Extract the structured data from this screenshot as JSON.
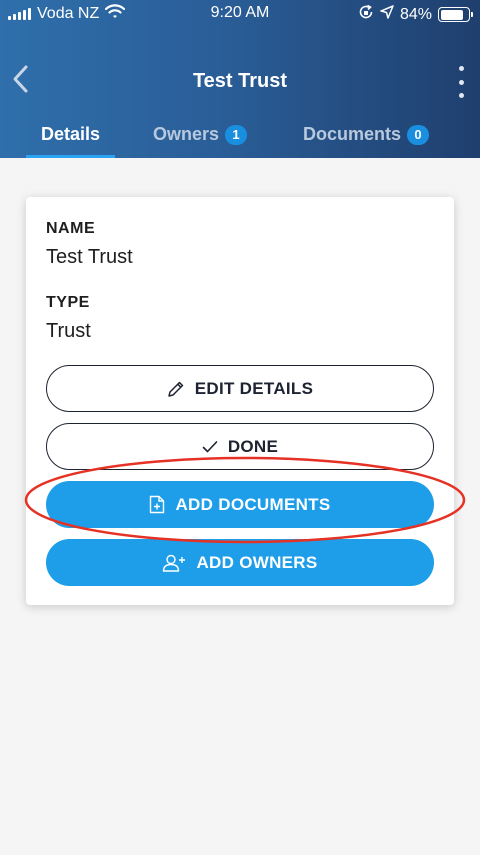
{
  "status_bar": {
    "carrier": "Voda NZ",
    "time": "9:20 AM",
    "battery_percent": "84%",
    "battery_level": 0.84
  },
  "nav": {
    "title": "Test Trust",
    "back_icon": "chevron-left-icon",
    "more_icon": "more-vertical-icon"
  },
  "tabs": [
    {
      "label": "Details",
      "active": true
    },
    {
      "label": "Owners",
      "count": "1"
    },
    {
      "label": "Documents",
      "count": "0"
    }
  ],
  "details": {
    "name_label": "NAME",
    "name_value": "Test Trust",
    "type_label": "TYPE",
    "type_value": "Trust"
  },
  "buttons": {
    "edit": "EDIT DETAILS",
    "done": "DONE",
    "add_documents": "ADD DOCUMENTS",
    "add_owners": "ADD OWNERS"
  },
  "colors": {
    "accent": "#1e9ee9",
    "header_start": "#2f6fab",
    "header_end": "#1f3f6e",
    "annotation": "#e53224"
  }
}
